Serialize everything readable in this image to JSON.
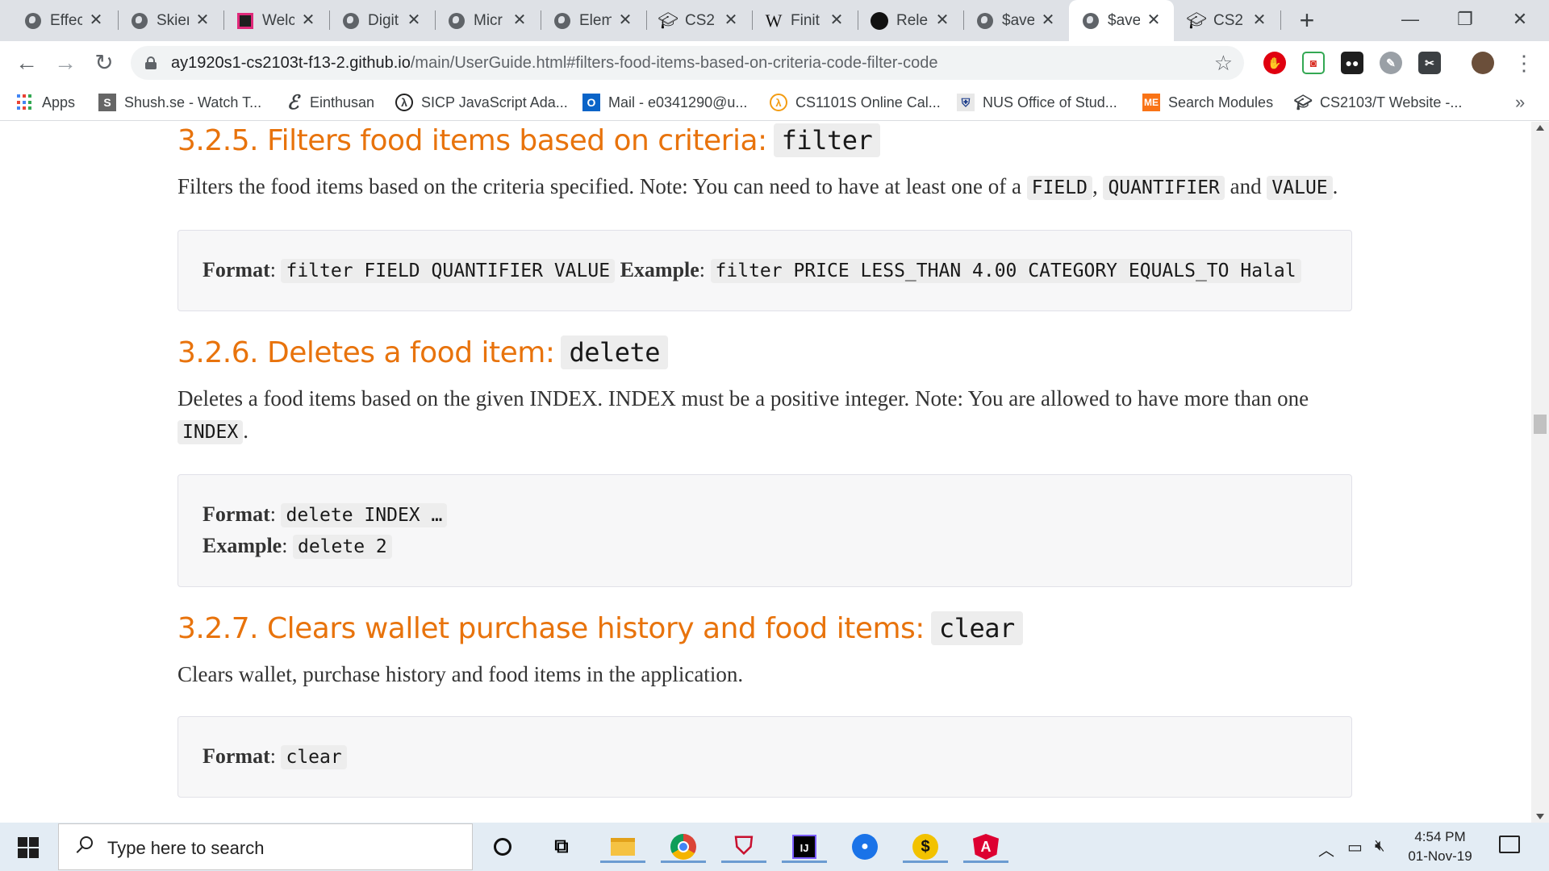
{
  "browser": {
    "tabs": [
      {
        "title": "Effec",
        "icon": "globe-icon"
      },
      {
        "title": "Skier",
        "icon": "globe-icon"
      },
      {
        "title": "Welc",
        "icon": "site-logo-icon"
      },
      {
        "title": "Digit",
        "icon": "globe-icon"
      },
      {
        "title": "Micr",
        "icon": "globe-icon"
      },
      {
        "title": "Elem",
        "icon": "globe-icon"
      },
      {
        "title": "CS2",
        "icon": "graduation-cap-icon"
      },
      {
        "title": "Finit",
        "icon": "wikipedia-icon"
      },
      {
        "title": "Rele",
        "icon": "github-icon"
      },
      {
        "title": "$ave",
        "icon": "globe-icon"
      },
      {
        "title": "$ave",
        "icon": "globe-icon",
        "active": true
      },
      {
        "title": "CS2",
        "icon": "graduation-cap-icon"
      }
    ],
    "new_tab_label": "+",
    "url_host": "ay1920s1-cs2103t-f13-2.github.io",
    "url_path": "/main/UserGuide.html#filters-food-items-based-on-criteria-code-filter-code",
    "bookmarks": [
      {
        "label": "Apps",
        "icon": "apps-grid-icon"
      },
      {
        "label": "Shush.se - Watch T...",
        "icon": "shush-icon"
      },
      {
        "label": "Einthusan",
        "icon": "einthusan-icon"
      },
      {
        "label": "SICP JavaScript Ada...",
        "icon": "sicp-icon"
      },
      {
        "label": "Mail - e0341290@u...",
        "icon": "outlook-icon"
      },
      {
        "label": "CS1101S Online Cal...",
        "icon": "source-academy-icon"
      },
      {
        "label": "NUS Office of Stud...",
        "icon": "nus-crest-icon"
      },
      {
        "label": "Search Modules",
        "icon": "nusmods-icon"
      },
      {
        "label": "CS2103/T Website -...",
        "icon": "graduation-cap-icon"
      }
    ],
    "bookmarks_more": "»"
  },
  "page": {
    "sections": [
      {
        "title": "3.2.5. Filters food items based on criteria:",
        "command": "filter",
        "desc_parts": {
          "t1": "Filters the food items based on the criteria specified. Note: You can need to have at least one of a",
          "c1": "FIELD",
          "t2": ",",
          "c2": "QUANTIFIER",
          "t3": "and",
          "c3": "VALUE",
          "t4": "."
        },
        "format_label": "Format",
        "format_code": "filter FIELD QUANTIFIER VALUE",
        "example_label": "Example",
        "example_code": "filter PRICE LESS_THAN 4.00 CATEGORY EQUALS_TO Halal"
      },
      {
        "title": "3.2.6. Deletes a food item:",
        "command": "delete",
        "desc_parts": {
          "t1": "Deletes a food items based on the given INDEX. INDEX must be a positive integer. Note: You are allowed to have more than one",
          "c1": "INDEX",
          "t2": "."
        },
        "format_label": "Format",
        "format_code": "delete INDEX …",
        "example_label": "Example",
        "example_code": "delete 2"
      },
      {
        "title": "3.2.7. Clears wallet purchase history and food items:",
        "command": "clear",
        "desc": "Clears wallet, purchase history and food items in the application.",
        "format_label": "Format",
        "format_code": "clear"
      }
    ]
  },
  "taskbar": {
    "search_placeholder": "Type here to search",
    "time": "4:54 PM",
    "date": "01-Nov-19",
    "pinned": [
      "cortana-icon",
      "task-view-icon",
      "file-explorer-icon",
      "chrome-icon",
      "mcafee-icon",
      "intellij-icon",
      "maps-icon",
      "money-icon",
      "angular-icon"
    ]
  },
  "colors": {
    "heading": "#e8730c",
    "tab_strip": "#dee1e6",
    "taskbar": "#e3ecf4"
  }
}
